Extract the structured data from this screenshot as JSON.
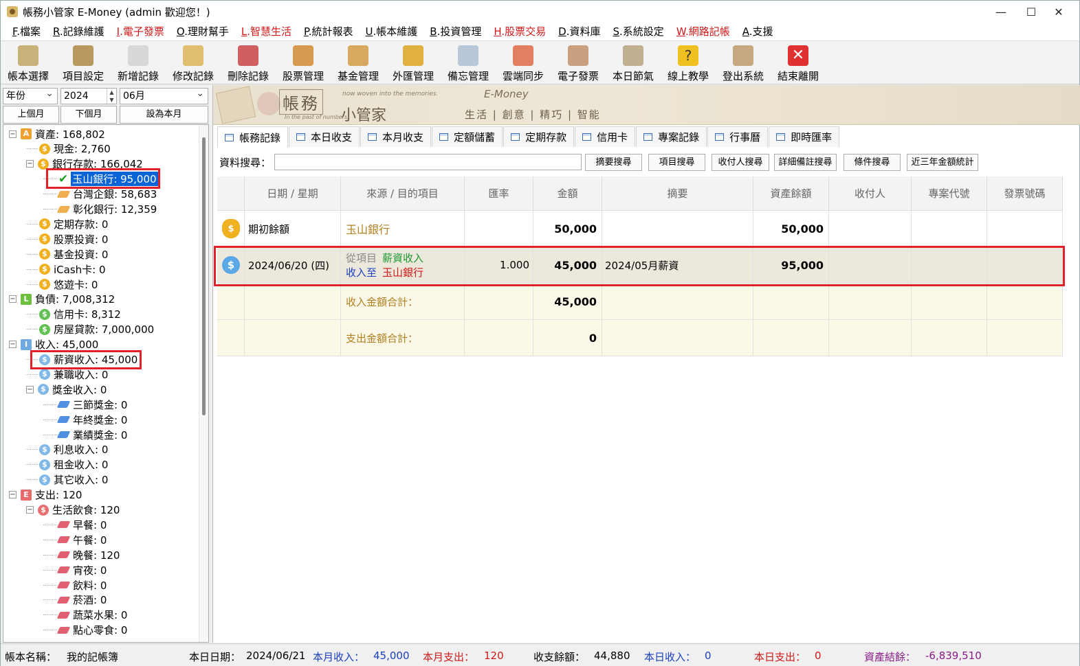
{
  "window": {
    "title": "帳務小管家 E-Money (admin 歡迎您！)"
  },
  "menu": [
    {
      "key": "F",
      "label": ".檔案",
      "red": false
    },
    {
      "key": "R",
      "label": ".記錄維護",
      "red": false
    },
    {
      "key": "I",
      "label": ".電子發票",
      "red": true
    },
    {
      "key": "O",
      "label": ".理財幫手",
      "red": false
    },
    {
      "key": "L",
      "label": ".智慧生活",
      "red": true
    },
    {
      "key": "P",
      "label": ".統計報表",
      "red": false
    },
    {
      "key": "U",
      "label": ".帳本維護",
      "red": false
    },
    {
      "key": "B",
      "label": ".投資管理",
      "red": false
    },
    {
      "key": "H",
      "label": ".股票交易",
      "red": true
    },
    {
      "key": "D",
      "label": ".資料庫",
      "red": false
    },
    {
      "key": "S",
      "label": ".系統設定",
      "red": false
    },
    {
      "key": "W",
      "label": ".網路記帳",
      "red": true
    },
    {
      "key": "A",
      "label": ".支援",
      "red": false
    }
  ],
  "toolbar": [
    {
      "label": "帳本選擇",
      "icon": "ledger-book-icon",
      "color": "#c9b27a"
    },
    {
      "label": "項目設定",
      "icon": "gear-document-icon",
      "color": "#b89a60"
    },
    {
      "label": "新增記錄",
      "icon": "add-document-icon",
      "color": "#d8d8d8"
    },
    {
      "label": "修改記錄",
      "icon": "edit-document-icon",
      "color": "#e0c070"
    },
    {
      "label": "刪除記錄",
      "icon": "delete-document-icon",
      "color": "#d06060"
    },
    {
      "label": "股票管理",
      "icon": "stock-chart-icon",
      "color": "#d89a50"
    },
    {
      "label": "基金管理",
      "icon": "fund-bank-icon",
      "color": "#d8a860"
    },
    {
      "label": "外匯管理",
      "icon": "currency-exchange-icon",
      "color": "#e0b040"
    },
    {
      "label": "備忘管理",
      "icon": "memo-clipboard-icon",
      "color": "#b8c8d8"
    },
    {
      "label": "雲端同步",
      "icon": "cloud-sync-icon",
      "color": "#e08060"
    },
    {
      "label": "電子發票",
      "icon": "qr-code-icon",
      "color": "#c8a080"
    },
    {
      "label": "本日節氣",
      "icon": "solar-term-icon",
      "color": "#c0b090"
    },
    {
      "label": "線上教學",
      "icon": "help-question-icon",
      "color": "#f0c020"
    },
    {
      "label": "登出系統",
      "icon": "logout-user-icon",
      "color": "#c8a880"
    },
    {
      "label": "結束離開",
      "icon": "exit-close-icon",
      "color": "#e03030"
    }
  ],
  "period": {
    "year_type": "年份",
    "year": "2024",
    "month": "06月",
    "prev": "上個月",
    "next": "下個月",
    "current": "設為本月"
  },
  "tree": [
    {
      "label": "資產: 168,802",
      "level": 0,
      "icon": "A",
      "color": "#f0a030",
      "expander": "−"
    },
    {
      "label": "現金: 2,760",
      "level": 1,
      "icon": "coin",
      "color": "#f0b020"
    },
    {
      "label": "銀行存款: 166,042",
      "level": 1,
      "icon": "coin",
      "color": "#f0b020",
      "expander": "−"
    },
    {
      "label": "玉山銀行: 95,000",
      "level": 2,
      "icon": "check",
      "color": "#1aa020",
      "selected": true
    },
    {
      "label": "台灣企銀: 58,683",
      "level": 2,
      "icon": "gem",
      "color": "#f0b050"
    },
    {
      "label": "彰化銀行: 12,359",
      "level": 2,
      "icon": "gem",
      "color": "#f0b050"
    },
    {
      "label": "定期存款: 0",
      "level": 1,
      "icon": "coin",
      "color": "#f0b020"
    },
    {
      "label": "股票投資: 0",
      "level": 1,
      "icon": "coin",
      "color": "#f0b020"
    },
    {
      "label": "基金投資: 0",
      "level": 1,
      "icon": "coin",
      "color": "#f0b020"
    },
    {
      "label": "iCash卡: 0",
      "level": 1,
      "icon": "coin",
      "color": "#f0b020"
    },
    {
      "label": "悠遊卡: 0",
      "level": 1,
      "icon": "coin",
      "color": "#f0b020"
    },
    {
      "label": "負債: 7,008,312",
      "level": 0,
      "icon": "L",
      "color": "#70c040",
      "expander": "−"
    },
    {
      "label": "信用卡: 8,312",
      "level": 1,
      "icon": "coin",
      "color": "#60c050"
    },
    {
      "label": "房屋貸款: 7,000,000",
      "level": 1,
      "icon": "coin",
      "color": "#60c050"
    },
    {
      "label": "收入: 45,000",
      "level": 0,
      "icon": "I",
      "color": "#70a8e0",
      "expander": "−"
    },
    {
      "label": "薪資收入: 45,000",
      "level": 1,
      "icon": "coin",
      "color": "#80b8e8"
    },
    {
      "label": "兼職收入: 0",
      "level": 1,
      "icon": "coin",
      "color": "#80b8e8"
    },
    {
      "label": "獎金收入: 0",
      "level": 1,
      "icon": "coin",
      "color": "#80b8e8",
      "expander": "−"
    },
    {
      "label": "三節獎金: 0",
      "level": 2,
      "icon": "gem",
      "color": "#5090e0"
    },
    {
      "label": "年終獎金: 0",
      "level": 2,
      "icon": "gem",
      "color": "#5090e0"
    },
    {
      "label": "業績獎金: 0",
      "level": 2,
      "icon": "gem",
      "color": "#5090e0"
    },
    {
      "label": "利息收入: 0",
      "level": 1,
      "icon": "coin",
      "color": "#80b8e8"
    },
    {
      "label": "租金收入: 0",
      "level": 1,
      "icon": "coin",
      "color": "#80b8e8"
    },
    {
      "label": "其它收入: 0",
      "level": 1,
      "icon": "coin",
      "color": "#80b8e8"
    },
    {
      "label": "支出: 120",
      "level": 0,
      "icon": "E",
      "color": "#e86a6a",
      "expander": "−"
    },
    {
      "label": "生活飲食: 120",
      "level": 1,
      "icon": "coin",
      "color": "#e87070",
      "expander": "−"
    },
    {
      "label": "早餐: 0",
      "level": 2,
      "icon": "gem",
      "color": "#e06070"
    },
    {
      "label": "午餐: 0",
      "level": 2,
      "icon": "gem",
      "color": "#e06070"
    },
    {
      "label": "晚餐: 120",
      "level": 2,
      "icon": "gem",
      "color": "#e06070"
    },
    {
      "label": "宵夜: 0",
      "level": 2,
      "icon": "gem",
      "color": "#e06070"
    },
    {
      "label": "飲料: 0",
      "level": 2,
      "icon": "gem",
      "color": "#e06070"
    },
    {
      "label": "菸酒: 0",
      "level": 2,
      "icon": "gem",
      "color": "#e06070"
    },
    {
      "label": "蔬菜水果: 0",
      "level": 2,
      "icon": "gem",
      "color": "#e06070"
    },
    {
      "label": "點心零食: 0",
      "level": 2,
      "icon": "gem",
      "color": "#e06070"
    }
  ],
  "banner": {
    "brand1": "帳務",
    "brand2": "小管家",
    "en": "E-Money",
    "tag1": "now woven into the memories.",
    "tag2": "In the past of numbers,",
    "slogan": "生活 | 創意 | 精巧 | 智能"
  },
  "tabs": [
    "帳務記錄",
    "本日收支",
    "本月收支",
    "定額儲蓄",
    "定期存款",
    "信用卡",
    "專案記錄",
    "行事曆",
    "即時匯率"
  ],
  "search": {
    "label": "資料搜尋：",
    "value": "",
    "buttons": [
      "摘要搜尋",
      "項目搜尋",
      "收付人搜尋",
      "詳細備註搜尋",
      "條件搜尋",
      "近三年金額統計"
    ]
  },
  "grid": {
    "headers": [
      "日期 / 星期",
      "來源 / 目的項目",
      "匯率",
      "金額",
      "摘要",
      "資產餘額",
      "收付人",
      "專案代號",
      "發票號碼"
    ],
    "opening": {
      "label": "期初餘額",
      "item": "玉山銀行",
      "amount": "50,000",
      "balance": "50,000"
    },
    "record": {
      "date": "2024/06/20 (四)",
      "from_label": "從項目",
      "from_item": "薪資收入",
      "to_label": "收入至",
      "to_item": "玉山銀行",
      "rate": "1.000",
      "amount": "45,000",
      "memo": "2024/05月薪資",
      "balance": "95,000"
    },
    "income_total": {
      "label": "收入金額合計：",
      "amount": "45,000"
    },
    "expense_total": {
      "label": "支出金額合計：",
      "amount": "0"
    }
  },
  "status": {
    "book_label": "帳本名稱：",
    "book": "我的記帳簿",
    "date_label": "本日日期：",
    "date": "2024/06/21",
    "month_income_label": "本月收入：",
    "month_income": "45,000",
    "month_expense_label": "本月支出：",
    "month_expense": "120",
    "balance_label": "收支餘額：",
    "balance": "44,880",
    "day_income_label": "本日收入：",
    "day_income": "0",
    "day_expense_label": "本日支出：",
    "day_expense": "0",
    "asset_label": "資產結餘：",
    "asset": "-6,839,510"
  }
}
